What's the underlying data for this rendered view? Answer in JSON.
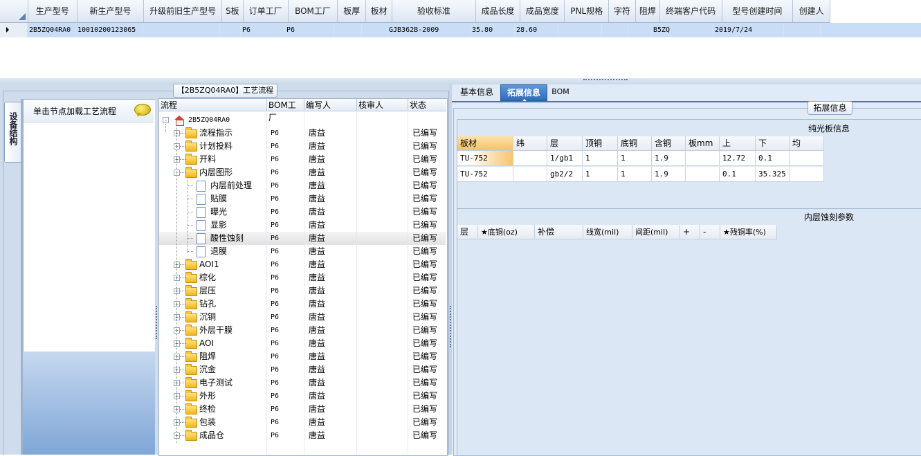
{
  "top_grid": {
    "columns": [
      "生产型号",
      "新生产型号",
      "升级前旧生产型号",
      "S板",
      "订单工厂",
      "BOM工厂",
      "板厚",
      "板材",
      "验收标准",
      "成品长度",
      "成品宽度",
      "PNL规格",
      "字符",
      "阻焊",
      "终端客户代码",
      "型号创建时间",
      "创建人"
    ],
    "row": [
      "2B5ZQ04RA0",
      "10010200123065",
      "",
      "",
      "P6",
      "P6",
      "",
      "",
      "GJB362B-2009",
      "35.80",
      "28.60",
      "",
      "",
      "",
      "B5ZQ",
      "2019/7/24",
      ""
    ]
  },
  "left": {
    "group_title": "【2B5ZQ04RA0】工艺流程",
    "side_tab": "设备结构",
    "node_hint": "单击节点加载工艺流程",
    "tree_columns": [
      "流程",
      "BOM工厂",
      "编写人",
      "核审人",
      "状态"
    ],
    "root": "2B5ZQ04RA0",
    "rows": [
      {
        "name": "流程指示",
        "bom": "P6",
        "author": "唐益",
        "reviewer": "",
        "status": "已编写",
        "type": "folder"
      },
      {
        "name": "计划投料",
        "bom": "P6",
        "author": "唐益",
        "reviewer": "",
        "status": "已编写",
        "type": "folder"
      },
      {
        "name": "开料",
        "bom": "P6",
        "author": "唐益",
        "reviewer": "",
        "status": "已编写",
        "type": "folder"
      },
      {
        "name": "内层图形",
        "bom": "P6",
        "author": "唐益",
        "reviewer": "",
        "status": "已编写",
        "type": "folder-open"
      },
      {
        "name": "内层前处理",
        "bom": "P6",
        "author": "唐益",
        "reviewer": "",
        "status": "已编写",
        "type": "doc"
      },
      {
        "name": "贴膜",
        "bom": "P6",
        "author": "唐益",
        "reviewer": "",
        "status": "已编写",
        "type": "doc"
      },
      {
        "name": "曝光",
        "bom": "P6",
        "author": "唐益",
        "reviewer": "",
        "status": "已编写",
        "type": "doc"
      },
      {
        "name": "显影",
        "bom": "P6",
        "author": "唐益",
        "reviewer": "",
        "status": "已编写",
        "type": "doc"
      },
      {
        "name": "酸性蚀刻",
        "bom": "P6",
        "author": "唐益",
        "reviewer": "",
        "status": "已编写",
        "type": "doc",
        "selected": true
      },
      {
        "name": "退膜",
        "bom": "P6",
        "author": "唐益",
        "reviewer": "",
        "status": "已编写",
        "type": "doc"
      },
      {
        "name": "AOI1",
        "bom": "P6",
        "author": "唐益",
        "reviewer": "",
        "status": "已编写",
        "type": "folder"
      },
      {
        "name": "棕化",
        "bom": "P6",
        "author": "唐益",
        "reviewer": "",
        "status": "已编写",
        "type": "folder"
      },
      {
        "name": "层压",
        "bom": "P6",
        "author": "唐益",
        "reviewer": "",
        "status": "已编写",
        "type": "folder"
      },
      {
        "name": "钻孔",
        "bom": "P6",
        "author": "唐益",
        "reviewer": "",
        "status": "已编写",
        "type": "folder"
      },
      {
        "name": "沉铜",
        "bom": "P6",
        "author": "唐益",
        "reviewer": "",
        "status": "已编写",
        "type": "folder"
      },
      {
        "name": "外层干膜",
        "bom": "P6",
        "author": "唐益",
        "reviewer": "",
        "status": "已编写",
        "type": "folder"
      },
      {
        "name": "AOI",
        "bom": "P6",
        "author": "唐益",
        "reviewer": "",
        "status": "已编写",
        "type": "folder"
      },
      {
        "name": "阻焊",
        "bom": "P6",
        "author": "唐益",
        "reviewer": "",
        "status": "已编写",
        "type": "folder"
      },
      {
        "name": "沉金",
        "bom": "P6",
        "author": "唐益",
        "reviewer": "",
        "status": "已编写",
        "type": "folder"
      },
      {
        "name": "电子测试",
        "bom": "P6",
        "author": "唐益",
        "reviewer": "",
        "status": "已编写",
        "type": "folder"
      },
      {
        "name": "外形",
        "bom": "P6",
        "author": "唐益",
        "reviewer": "",
        "status": "已编写",
        "type": "folder"
      },
      {
        "name": "终检",
        "bom": "P6",
        "author": "唐益",
        "reviewer": "",
        "status": "已编写",
        "type": "folder"
      },
      {
        "name": "包装",
        "bom": "P6",
        "author": "唐益",
        "reviewer": "",
        "status": "已编写",
        "type": "folder"
      },
      {
        "name": "成品仓",
        "bom": "P6",
        "author": "唐益",
        "reviewer": "",
        "status": "已编写",
        "type": "folder"
      }
    ]
  },
  "right": {
    "tabs": [
      "基本信息",
      "拓展信息",
      "BOM"
    ],
    "group_title": "拓展信息",
    "panel1_title": "纯光板信息",
    "panel1_columns": [
      "板材",
      "纬",
      "层",
      "顶铜",
      "底铜",
      "含铜",
      "板mm",
      "上",
      "下",
      "均"
    ],
    "panel1_rows": [
      [
        "TU-752",
        "",
        "1/gb1",
        "1",
        "1",
        "1.9",
        "",
        "12.72",
        "0.1",
        ""
      ],
      [
        "TU-752",
        "",
        "gb2/2",
        "1",
        "1",
        "1.9",
        "",
        "0.1",
        "35.325",
        ""
      ]
    ],
    "panel2_title": "内层蚀刻参数",
    "panel2_columns": [
      "层",
      "★底铜(oz)",
      "补偿",
      "线宽(mil)",
      "间距(mil)",
      "+",
      "-",
      "★残铜率(%)"
    ]
  },
  "colors": {
    "accent": "#2e6cbf",
    "selected_row": "#c9def6",
    "highlight_cell": "#f7c56d"
  }
}
